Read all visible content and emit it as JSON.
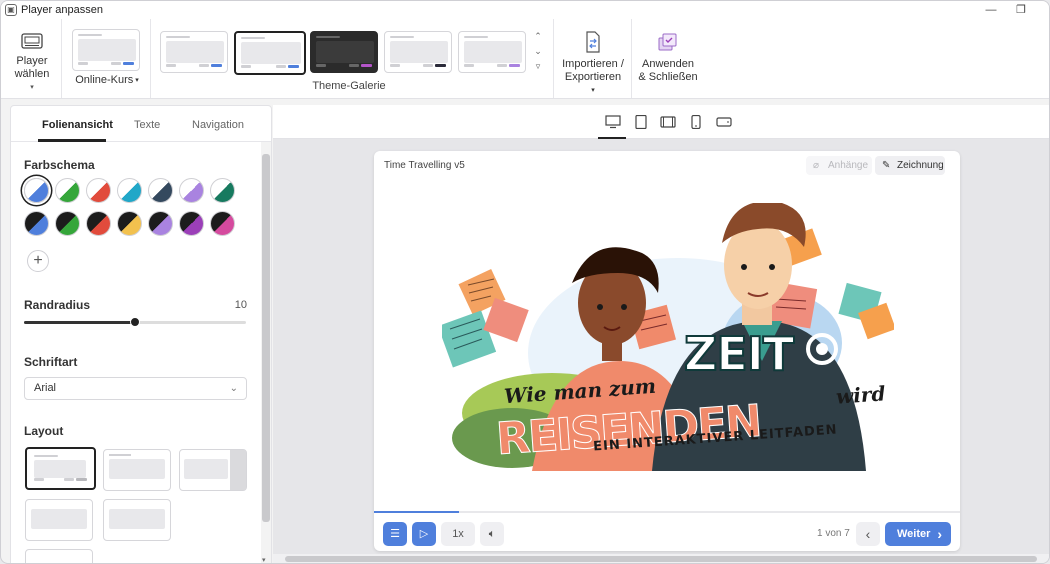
{
  "window": {
    "title": "Player anpassen"
  },
  "ribbon": {
    "player_select_label": "Player wählen",
    "course_type_label": "Online-Kurs",
    "theme_gallery_label": "Theme-Galerie",
    "import_export_label": "Importieren / Exportieren",
    "apply_close_label": "Anwenden & Schließen",
    "theme_accents": [
      "#4f7fdc",
      "#4f7fdc",
      "#b455c9",
      "#2b2b3a",
      "#a983e0"
    ]
  },
  "left_panel": {
    "tabs": [
      "Folienansicht",
      "Texte",
      "Navigation"
    ],
    "color_scheme_title": "Farbschema",
    "border_radius_title": "Randradius",
    "border_radius_value": "10",
    "border_radius_fraction": 0.5,
    "font_title": "Schriftart",
    "font_value": "Arial",
    "layout_title": "Layout",
    "swatch_colors": [
      "#4f7fdc",
      "#35a63a",
      "#e14b3c",
      "#21a7c8",
      "#34495e",
      "#a983e0",
      "#177a5f"
    ],
    "swatch_colors_dark": [
      "#4f7fdc",
      "#35a63a",
      "#e14b3c",
      "#f2c14e",
      "#a983e0",
      "#9b3fb8",
      "#d54a9e"
    ]
  },
  "preview": {
    "course_title": "Time Travelling v5",
    "attachments_label": "Anhänge",
    "drawing_label": "Zeichnung",
    "speed_label": "1x",
    "page_indicator": "1 von 7",
    "next_label": "Weiter",
    "progress_fraction": 0.145
  },
  "slide": {
    "line1": "Wie man zum",
    "line2": "ZEIT",
    "line3": "REISENDEN",
    "line4": "wird",
    "line5": "EIN INTERAKTIVER LEITFADEN"
  }
}
